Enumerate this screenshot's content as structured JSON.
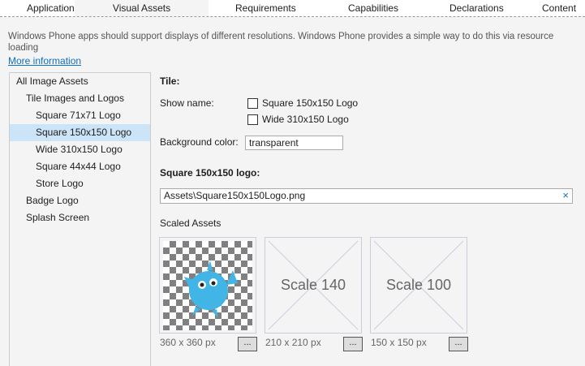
{
  "tabs": [
    {
      "label": "Application"
    },
    {
      "label": "Visual Assets"
    },
    {
      "label": "Requirements"
    },
    {
      "label": "Capabilities"
    },
    {
      "label": "Declarations"
    },
    {
      "label": "Content"
    }
  ],
  "description": "Windows Phone apps should support displays of different resolutions. Windows Phone provides a simple way to do this via resource loading",
  "more_info": "More information",
  "tree": [
    {
      "label": "All Image Assets"
    },
    {
      "label": "Tile Images and Logos"
    },
    {
      "label": "Square 71x71 Logo"
    },
    {
      "label": "Square 150x150 Logo"
    },
    {
      "label": "Wide 310x150 Logo"
    },
    {
      "label": "Square 44x44 Logo"
    },
    {
      "label": "Store Logo"
    },
    {
      "label": "Badge Logo"
    },
    {
      "label": "Splash Screen"
    }
  ],
  "tile": {
    "heading": "Tile:",
    "show_name_label": "Show name:",
    "checkbox1": "Square 150x150 Logo",
    "checkbox2": "Wide 310x150 Logo",
    "bg_label": "Background color:",
    "bg_value": "transparent"
  },
  "logo": {
    "heading": "Square 150x150 logo:",
    "path": "Assets\\Square150x150Logo.png",
    "clear_icon": "×"
  },
  "scaled": {
    "heading": "Scaled Assets",
    "assets": [
      {
        "size": "360 x 360 px",
        "label": ""
      },
      {
        "size": "210 x 210 px",
        "label": "Scale 140"
      },
      {
        "size": "150 x 150 px",
        "label": "Scale 100"
      }
    ],
    "button": "..."
  },
  "colors": {
    "selected": "#cce4f7",
    "link": "#0e70c0",
    "mascot": "#41b6e6"
  }
}
